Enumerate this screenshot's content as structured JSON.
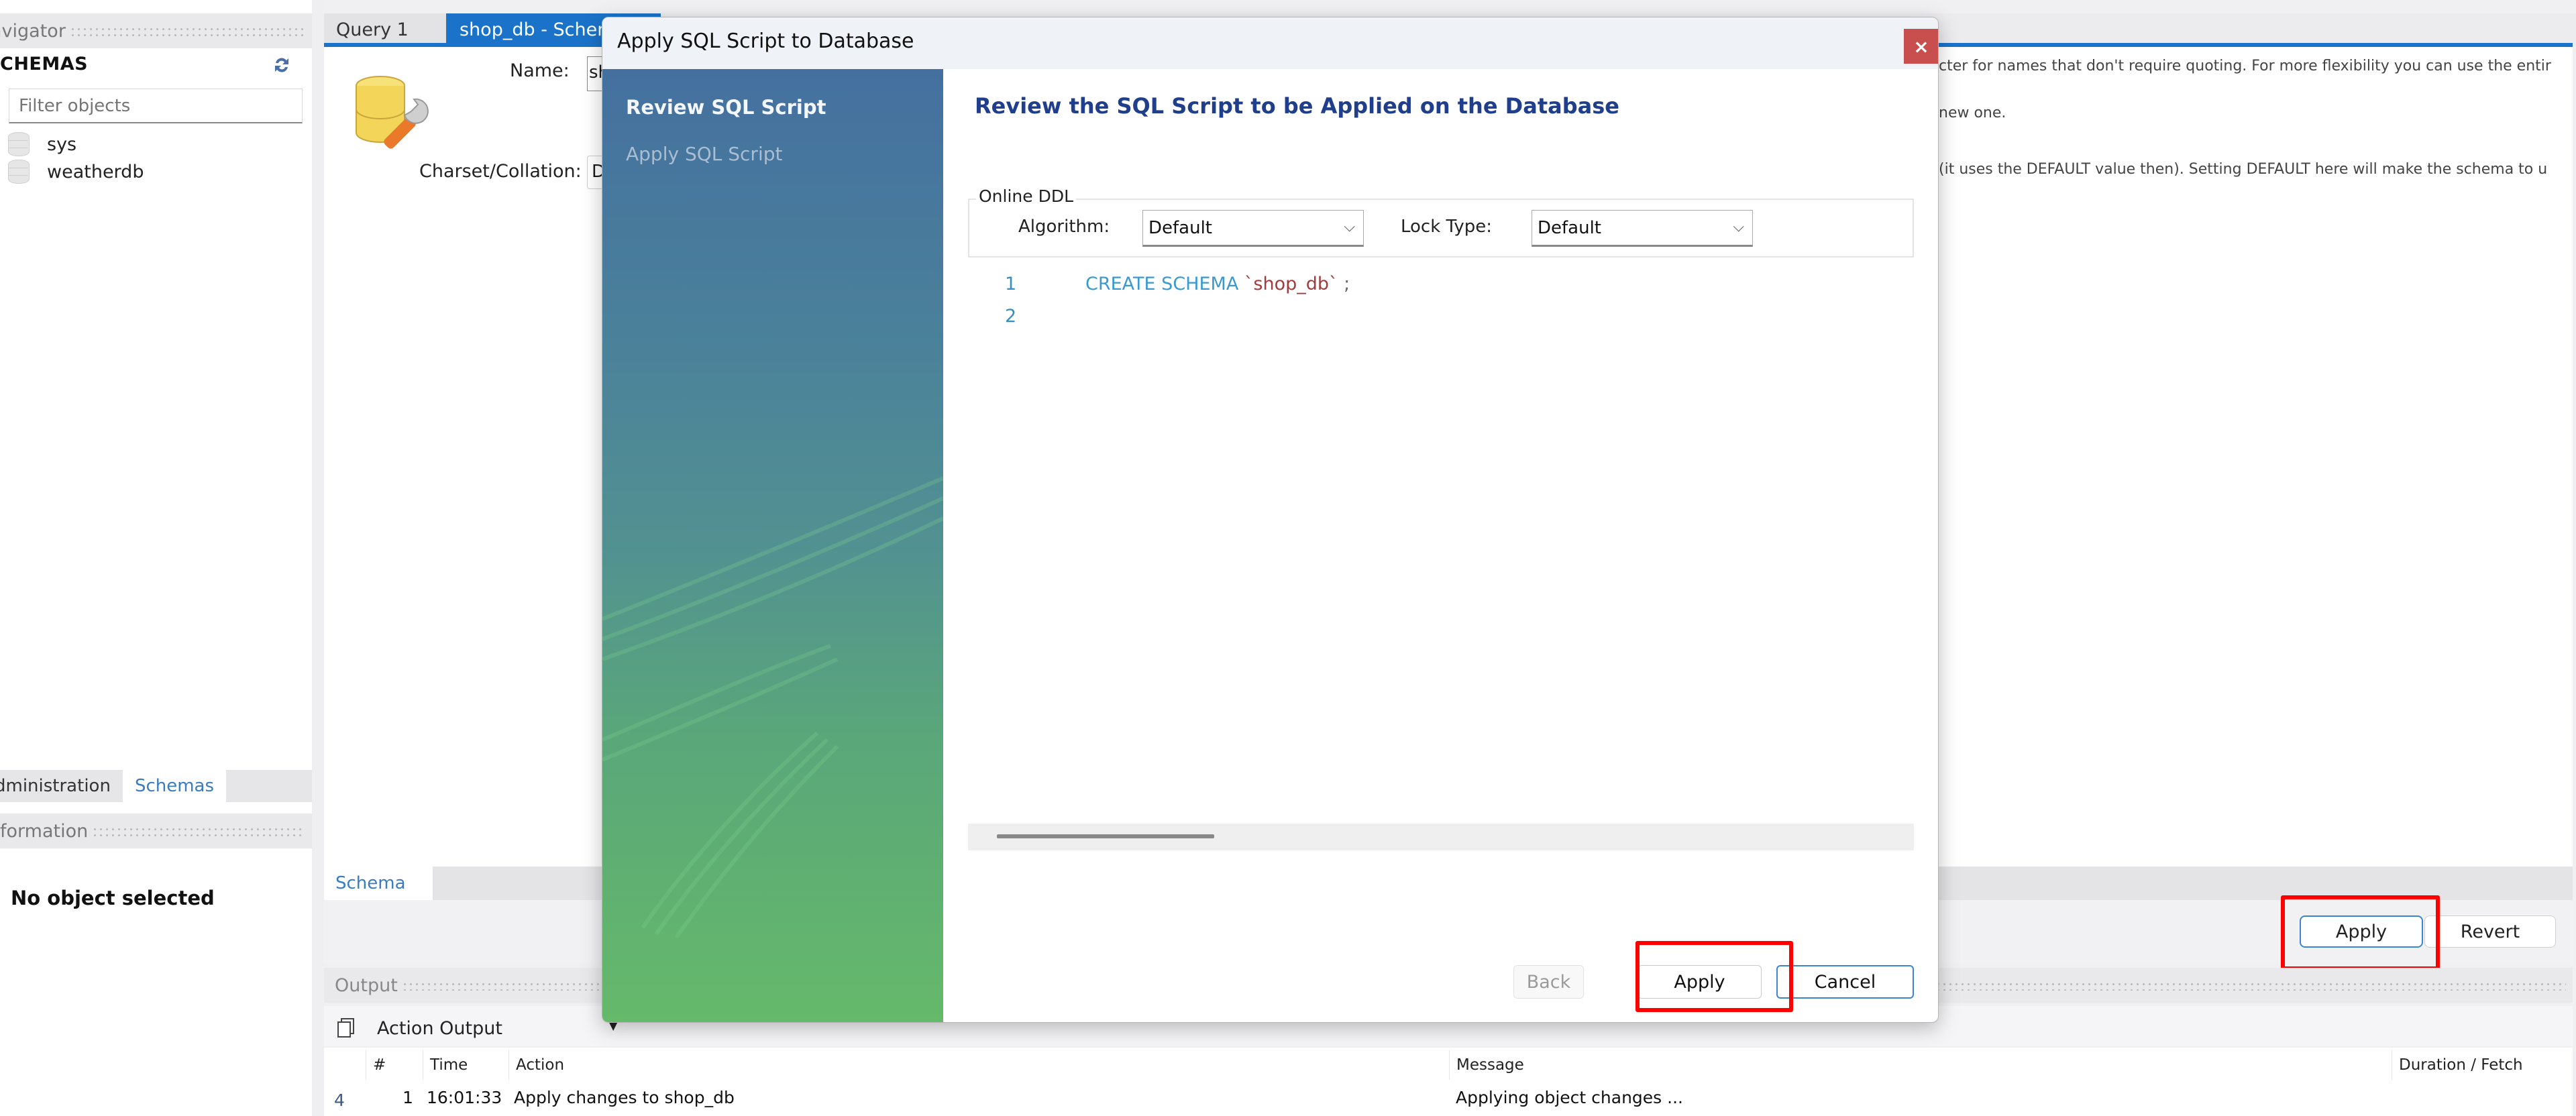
{
  "navigator": {
    "header": "avigator",
    "schemas_title": "CHEMAS",
    "filter_placeholder": "Filter objects",
    "schemas": [
      {
        "name": "sys"
      },
      {
        "name": "weatherdb"
      }
    ],
    "tabs": [
      {
        "label": "dministration",
        "active": false
      },
      {
        "label": "Schemas",
        "active": true
      }
    ],
    "info_header": "formation",
    "no_object": "No object selected"
  },
  "editor": {
    "tabs": [
      {
        "label": "Query 1",
        "active": false
      },
      {
        "label": "shop_db - Schema",
        "active": true
      }
    ],
    "name_label": "Name:",
    "name_value": "shop_db",
    "charset_label": "Charset/Collation:",
    "charset_value": "Default",
    "hints": [
      "cter for names that don't require quoting. For more flexibility you can use the entir",
      "new one.",
      "(it uses the DEFAULT value then). Setting DEFAULT here will make the schema to u"
    ],
    "bottom_tab": "Schema",
    "apply_label": "Apply",
    "revert_label": "Revert"
  },
  "output": {
    "header": "Output",
    "selector": "Action Output",
    "columns": [
      "#",
      "Time",
      "Action",
      "Message",
      "Duration / Fetch"
    ],
    "rows": [
      {
        "status": "4",
        "num": "1",
        "time": "16:01:33",
        "action": "Apply changes to shop_db",
        "message": "Applying object changes ...",
        "duration": ""
      }
    ]
  },
  "dialog": {
    "title": "Apply SQL Script to Database",
    "close_label": "×",
    "steps": [
      {
        "label": "Review SQL Script",
        "active": true
      },
      {
        "label": "Apply SQL Script",
        "active": false
      }
    ],
    "heading": "Review the SQL Script to be Applied on the Database",
    "online_ddl": {
      "legend": "Online DDL",
      "algorithm_label": "Algorithm:",
      "algorithm_value": "Default",
      "lock_label": "Lock Type:",
      "lock_value": "Default"
    },
    "script": {
      "line_numbers": [
        "1",
        "2"
      ],
      "keyword": "CREATE SCHEMA",
      "identifier": "`shop_db`",
      "terminator": ";"
    },
    "buttons": {
      "back": "Back",
      "apply": "Apply",
      "cancel": "Cancel"
    }
  },
  "colors": {
    "accent": "#1a73c8",
    "close_button": "#c94f4f",
    "highlight_box": "#ff0000",
    "heading": "#1f3e8c"
  }
}
